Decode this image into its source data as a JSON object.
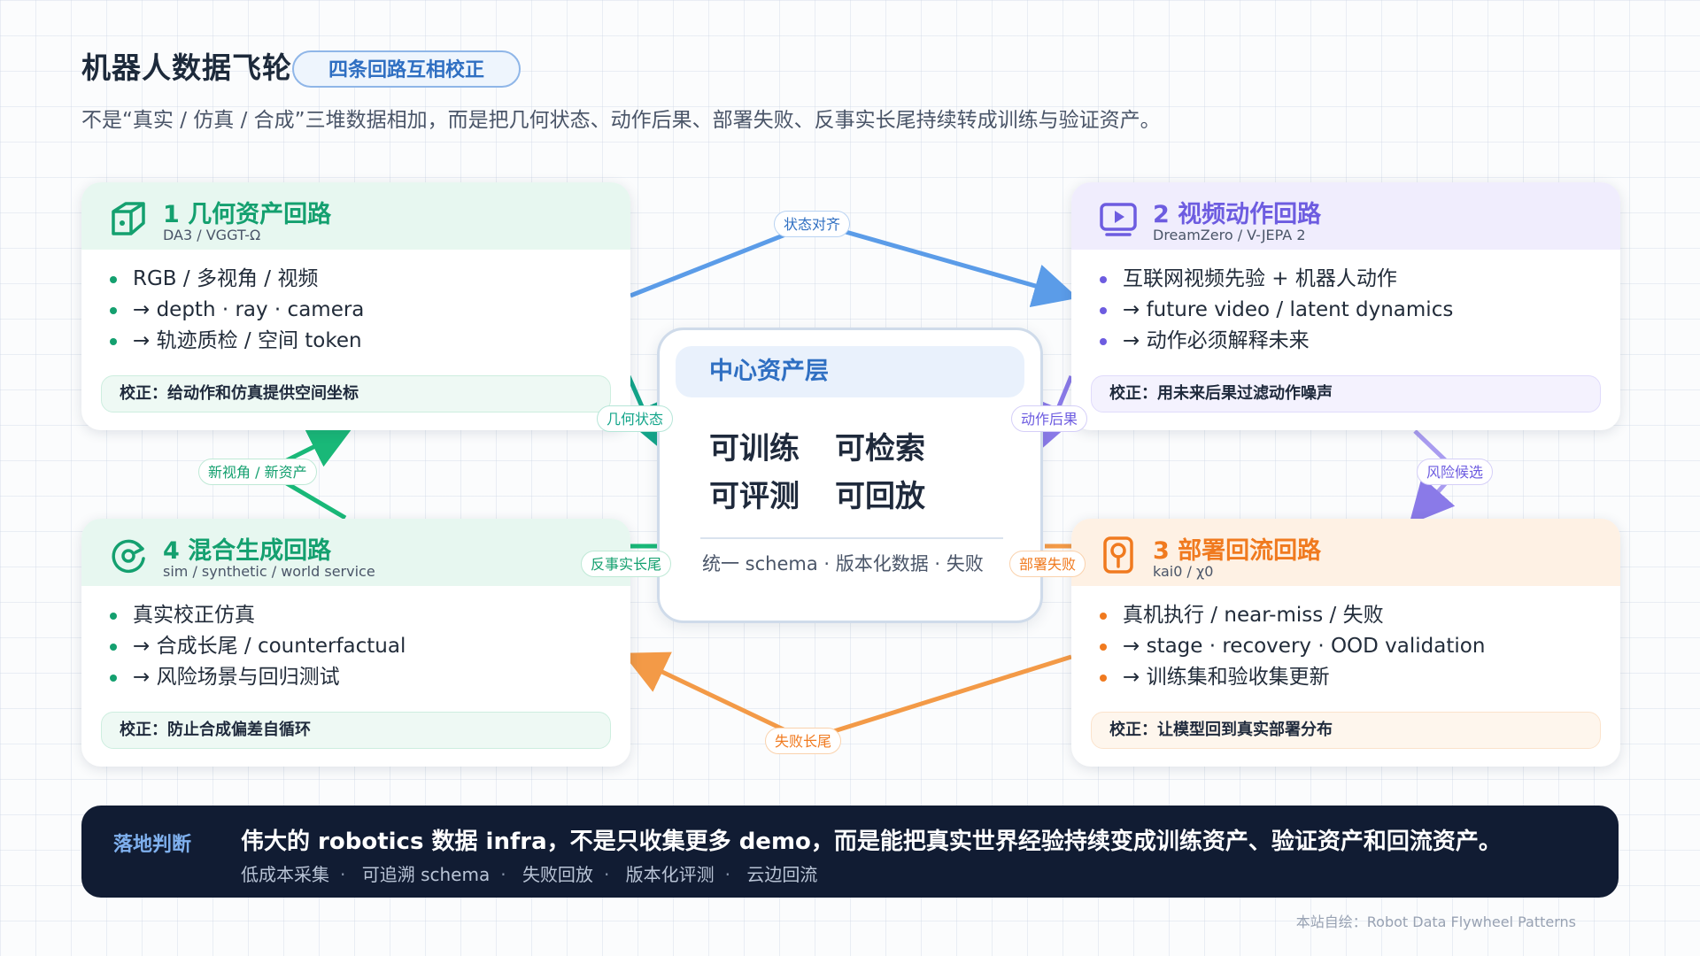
{
  "header": {
    "title": "机器人数据飞轮",
    "badge": "四条回路互相校正",
    "subtitle": "不是“真实 / 仿真 / 合成”三堆数据相加，而是把几何状态、动作后果、部署失败、反事实长尾持续转成训练与验证资产。"
  },
  "cards": {
    "geometry": {
      "title": "1  几何资产回路",
      "sub": "DA3 / VGGT-Ω",
      "items": [
        "RGB / 多视角 / 视频",
        "→ depth ·   ray ·   camera",
        "→ 轨迹质检 / 空间 token"
      ],
      "check": "校正：给动作和仿真提供空间坐标",
      "color": "#14a06f",
      "icon": "cube-icon"
    },
    "video": {
      "title": "2  视频动作回路",
      "sub": "DreamZero / V-JEPA 2",
      "items": [
        "互联网视频先验 + 机器人动作",
        "→ future video / latent dynamics",
        "→ 动作必须解释未来"
      ],
      "check": "校正：用未来后果过滤动作噪声",
      "color": "#6d5ce0",
      "icon": "play-icon"
    },
    "deploy": {
      "title": "3  部署回流回路",
      "sub": "kai0 / χ0",
      "items": [
        "真机执行 / near-miss / 失败",
        "→ stage ·   recovery ·   OOD validation",
        "→ 训练集和验收集更新"
      ],
      "check": "校正：让模型回到真实部署分布",
      "color": "#f07a1f",
      "icon": "robot-icon"
    },
    "mixed": {
      "title": "4  混合生成回路",
      "sub": "sim / synthetic / world service",
      "items": [
        "真实校正仿真",
        "→ 合成长尾 / counterfactual",
        "→ 风险场景与回归测试"
      ],
      "check": "校正：防止合成偏差自循环",
      "color": "#14a06f",
      "icon": "cycle-icon"
    }
  },
  "hub": {
    "title": "中心资产层",
    "cells": [
      "可训练",
      "可检索",
      "可评测",
      "可回放"
    ],
    "footer": "统一 schema ·   版本化数据 ·   失败"
  },
  "arrows": {
    "state_align": "状态对齐",
    "geo_state": "几何状态",
    "action_result": "动作后果",
    "risk_select": "风险候选",
    "new_view": "新视角 / 新资产",
    "counterfactual": "反事实长尾",
    "deploy_fail": "部署失败",
    "fail_tail": "失败长尾"
  },
  "bottom": {
    "tag": "落地判断",
    "main": "伟大的 robotics 数据 infra，不是只收集更多 demo，而是能把真实世界经验持续变成训练资产、验证资产和回流资产。",
    "tags": [
      "低成本采集",
      "可追溯 schema",
      "失败回放",
      "版本化评测",
      "云边回流"
    ]
  },
  "credit": "本站自绘：Robot Data Flywheel Patterns",
  "colors": {
    "blue": "#5b9ce8",
    "green": "#19b878",
    "purple": "#8a7ae8",
    "orange": "#f39a47",
    "navy": "#111c33"
  }
}
